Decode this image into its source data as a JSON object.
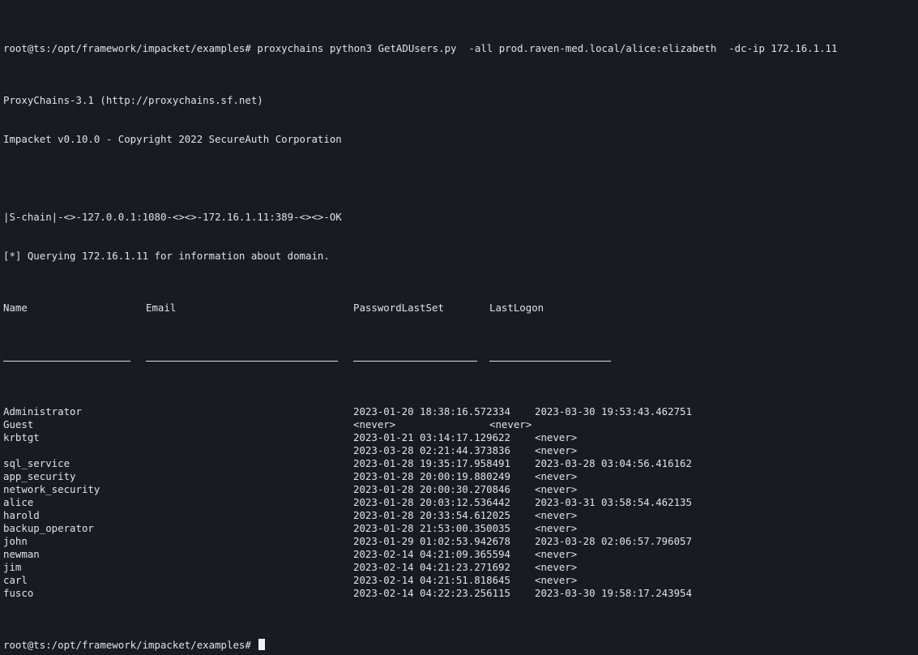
{
  "terminal": {
    "prompt": "root@ts:/opt/framework/impacket/examples#",
    "command": "proxychains python3 GetADUsers.py  -all prod.raven-med.local/alice:elizabeth  -dc-ip 172.16.1.11",
    "output_lines": [
      "ProxyChains-3.1 (http://proxychains.sf.net)",
      "Impacket v0.10.0 - Copyright 2022 SecureAuth Corporation",
      "",
      "|S-chain|-<>-127.0.0.1:1080-<><>-172.16.1.11:389-<><>-OK",
      "[*] Querying 172.16.1.11 for information about domain."
    ],
    "table": {
      "headers": [
        "Name",
        "Email",
        "PasswordLastSet",
        "LastLogon"
      ],
      "rows": [
        {
          "name": "Administrator",
          "email": "",
          "pwd": "2023-01-20 18:38:16.572334",
          "logon": "2023-03-30 19:53:43.462751"
        },
        {
          "name": "Guest",
          "email": "",
          "pwd": "<never>",
          "logon": "<never>"
        },
        {
          "name": "krbtgt",
          "email": "",
          "pwd": "2023-01-21 03:14:17.129622",
          "logon": "<never>"
        },
        {
          "name": "",
          "email": "",
          "pwd": "2023-03-28 02:21:44.373836",
          "logon": "<never>"
        },
        {
          "name": "sql_service",
          "email": "",
          "pwd": "2023-01-28 19:35:17.958491",
          "logon": "2023-03-28 03:04:56.416162"
        },
        {
          "name": "app_security",
          "email": "",
          "pwd": "2023-01-28 20:00:19.880249",
          "logon": "<never>"
        },
        {
          "name": "network_security",
          "email": "",
          "pwd": "2023-01-28 20:00:30.270846",
          "logon": "<never>"
        },
        {
          "name": "alice",
          "email": "",
          "pwd": "2023-01-28 20:03:12.536442",
          "logon": "2023-03-31 03:58:54.462135"
        },
        {
          "name": "harold",
          "email": "",
          "pwd": "2023-01-28 20:33:54.612025",
          "logon": "<never>"
        },
        {
          "name": "backup_operator",
          "email": "",
          "pwd": "2023-01-28 21:53:00.350035",
          "logon": "<never>"
        },
        {
          "name": "john",
          "email": "",
          "pwd": "2023-01-29 01:02:53.942678",
          "logon": "2023-03-28 02:06:57.796057"
        },
        {
          "name": "newman",
          "email": "",
          "pwd": "2023-02-14 04:21:09.365594",
          "logon": "<never>"
        },
        {
          "name": "jim",
          "email": "",
          "pwd": "2023-02-14 04:21:23.271692",
          "logon": "<never>"
        },
        {
          "name": "carl",
          "email": "",
          "pwd": "2023-02-14 04:21:51.818645",
          "logon": "<never>"
        },
        {
          "name": "fusco",
          "email": "",
          "pwd": "2023-02-14 04:22:23.256115",
          "logon": "2023-03-30 19:58:17.243954"
        }
      ]
    },
    "final_prompt": "root@ts:/opt/framework/impacket/examples#"
  }
}
